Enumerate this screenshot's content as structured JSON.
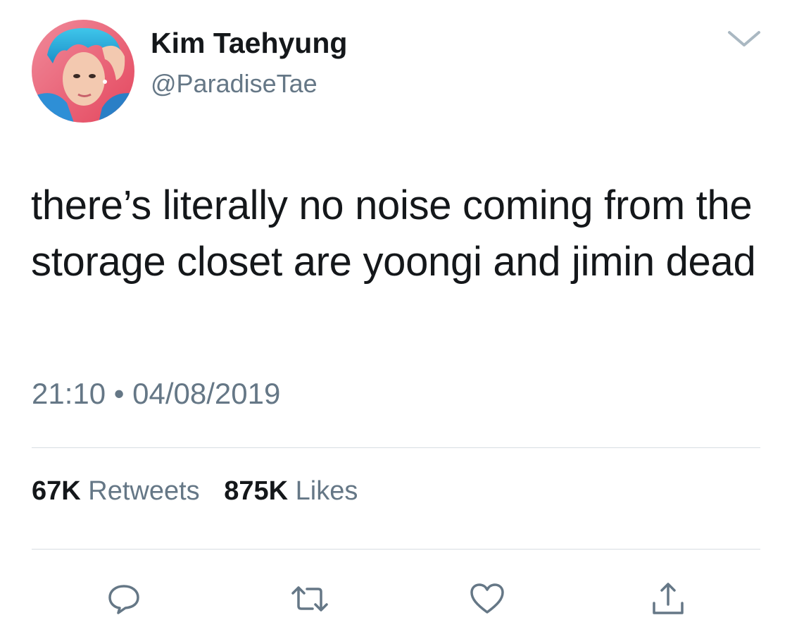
{
  "author": {
    "display_name": "Kim Taehyung",
    "handle": "@ParadiseTae",
    "avatar_icon": "profile-photo"
  },
  "tweet": {
    "text": "there’s literally no noise coming from the storage closet are yoongi and jimin dead",
    "timestamp": "21:10 • 04/08/2019"
  },
  "stats": {
    "retweets_count": "67K",
    "retweets_label": "Retweets",
    "likes_count": "875K",
    "likes_label": "Likes"
  },
  "actions": [
    {
      "icon": "reply-icon"
    },
    {
      "icon": "retweet-icon"
    },
    {
      "icon": "like-icon"
    },
    {
      "icon": "share-icon"
    }
  ],
  "colors": {
    "text_primary": "#14171a",
    "text_secondary": "#657786",
    "divider": "#d8dde2",
    "icon": "#657786"
  }
}
